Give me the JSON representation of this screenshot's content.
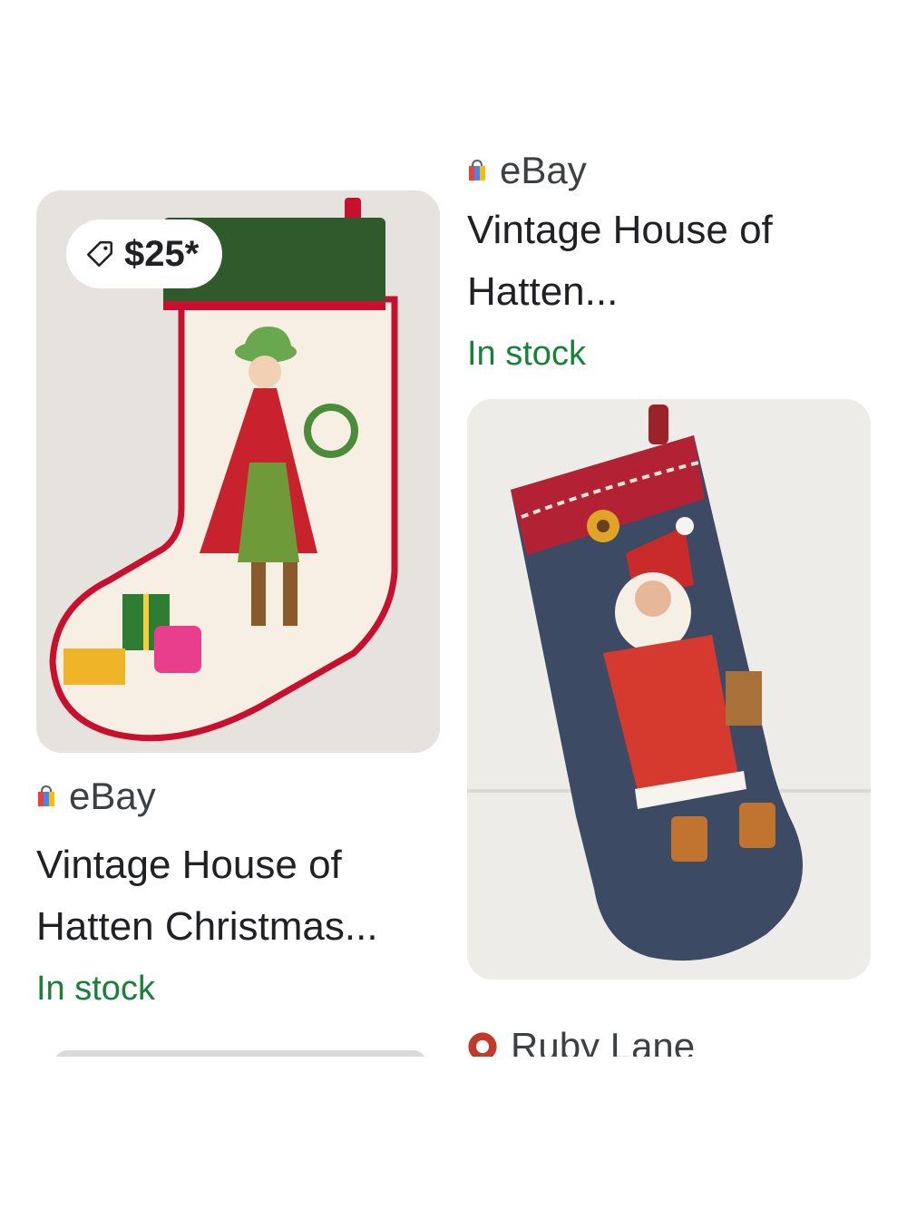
{
  "results": [
    {
      "price": "$25*",
      "source": "eBay",
      "title": "Vintage House of Hatten Christmas...",
      "stock": "In stock",
      "image_icon": "christmas-stocking-lady-image"
    },
    {
      "source": "eBay",
      "title_line1": "Vintage House of",
      "title_line2": "Hatten...",
      "stock": "In stock",
      "image_icon": "christmas-stocking-santa-image"
    }
  ],
  "next": {
    "source": "Ruby Lane"
  },
  "colors": {
    "stock_green": "#188038",
    "stocking_red": "#c8102e",
    "cuff_green": "#2f5a2b"
  }
}
